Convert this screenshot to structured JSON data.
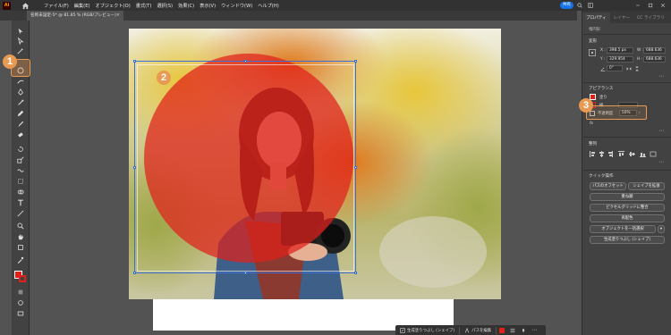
{
  "app": {
    "logo": "Ai",
    "menus": [
      "ファイル(F)",
      "編集(E)",
      "オブジェクト(O)",
      "書式(T)",
      "選択(S)",
      "効果(C)",
      "表示(V)",
      "ウィンドウ(W)",
      "ヘルプ(H)"
    ],
    "share_label": "共有"
  },
  "document": {
    "tab_title": "名称未設定-5* @ 81.85 % (RGB/プレビュー)",
    "close": "×"
  },
  "badges": [
    "1",
    "2",
    "3"
  ],
  "context_bar": {
    "generative_fill": "生成塗りつぶし (シェイプ)",
    "edit_path": "パスを編集"
  },
  "panel": {
    "tabs": [
      "プロパティ",
      "レイヤー",
      "CC ライブラリ"
    ],
    "section_unselected": "楕円形",
    "transform_title": "変形",
    "x_label": "X :",
    "x_value": "398.5 px",
    "y_label": "Y :",
    "y_value": "329.954",
    "w_label": "W :",
    "w_value": "688.636",
    "h_label": "H :",
    "h_value": "688.636",
    "angle_value": "0°",
    "appearance_title": "アピアランス",
    "fill_label": "塗り",
    "stroke_label": "線",
    "opacity_label": "不透明度",
    "opacity_value": "50%",
    "fx_label": "fx",
    "align_title": "整列",
    "quick_actions_title": "クイック操作",
    "btn_offset_path": "パスのオフセット",
    "btn_expand_shape": "シェイプを拡張",
    "btn_expand": "重ね順",
    "btn_pixel_grid": "ピクセルグリッドに整合",
    "btn_recolor": "再配色",
    "btn_select_same": "オブジェクトを一括選択",
    "btn_generative_fill": "生成塗りつぶし (シェイプ)"
  },
  "colors": {
    "accent_orange": "#e89a52",
    "fill_red": "#e0201b",
    "selection_blue": "#3b6fd8",
    "share_blue": "#1473e6"
  }
}
